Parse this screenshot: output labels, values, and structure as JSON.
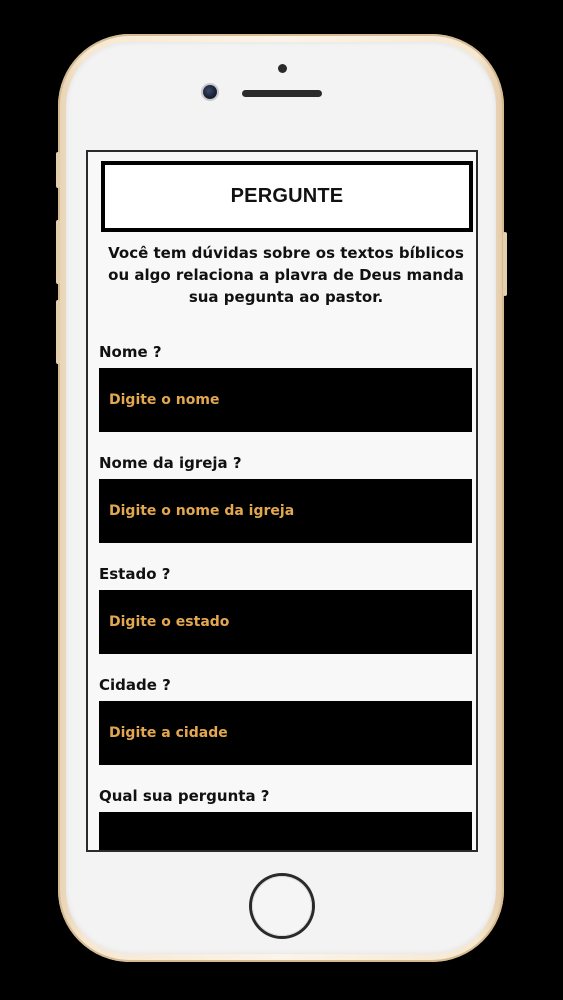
{
  "screen": {
    "title": "PERGUNTE",
    "intro": "Você tem dúvidas sobre os textos bíblicos ou algo relaciona a plavra de Deus manda sua pegunta ao pastor."
  },
  "form": {
    "fields": [
      {
        "label": "Nome ?",
        "placeholder": "Digite o nome"
      },
      {
        "label": "Nome da igreja ?",
        "placeholder": "Digite o nome da igreja"
      },
      {
        "label": "Estado ?",
        "placeholder": "Digite o estado"
      },
      {
        "label": "Cidade ?",
        "placeholder": "Digite a cidade"
      },
      {
        "label": "Qual sua pergunta ?",
        "placeholder": ""
      }
    ]
  },
  "colors": {
    "background": "#000000",
    "screen_bg": "#f8f8f8",
    "input_bg": "#000000",
    "placeholder": "#e3a84f",
    "text": "#111111",
    "phone_frame": "#f6e8d2"
  }
}
